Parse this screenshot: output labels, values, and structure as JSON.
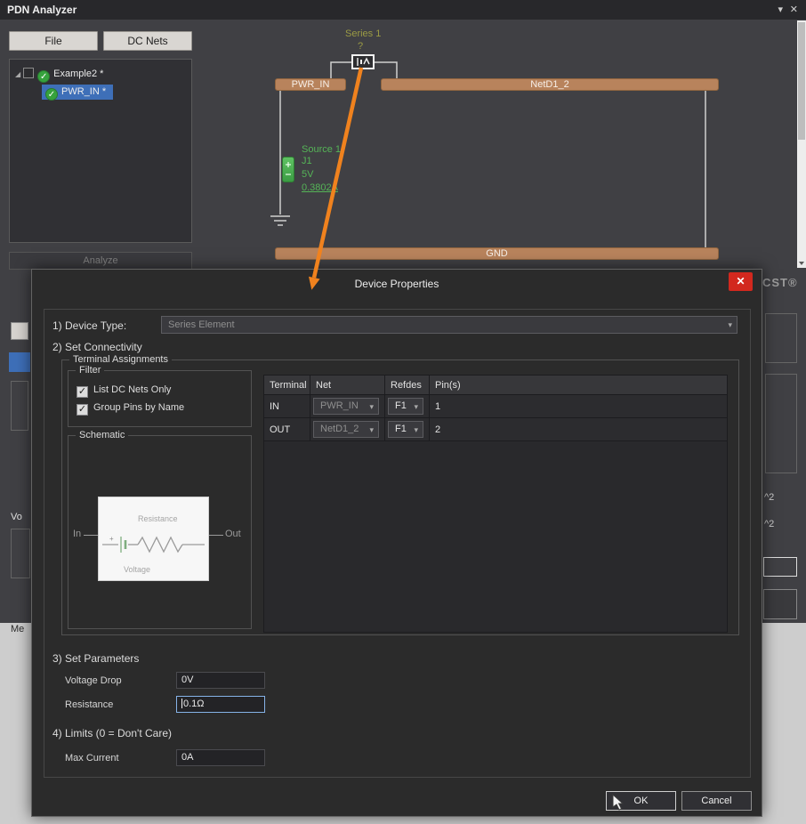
{
  "glyphs": {
    "check": "✓",
    "caret_down": "▾",
    "close": "✕",
    "expander": "◢"
  },
  "window": {
    "title": "PDN Analyzer"
  },
  "toolbar": {
    "file": "File",
    "dc_nets": "DC Nets"
  },
  "tree": {
    "root_label": "Example2 *",
    "child_label": "PWR_IN *"
  },
  "analyze_label": "Analyze",
  "canvas": {
    "series_label": "Series 1",
    "series_value": "?",
    "net_pwr": "PWR_IN",
    "net_netd": "NetD1_2",
    "net_gnd": "GND",
    "source_name": "Source 1",
    "source_refdes": "J1",
    "source_voltage": "5V",
    "source_current": "0.3802A"
  },
  "background": {
    "cst": "CST®",
    "frag_vo": "Vo",
    "frag_me": "Me",
    "frag_sq1": "^2",
    "frag_sq2": "^2"
  },
  "dialog": {
    "title": "Device Properties",
    "device_type_label": "1) Device Type:",
    "device_type_value": "Series Element",
    "connectivity_label": "2) Set Connectivity",
    "terminal_assignments_label": "Terminal Assignments",
    "filter": {
      "label": "Filter",
      "options": [
        {
          "label": "List DC Nets Only",
          "checked": true
        },
        {
          "label": "Group Pins by Name",
          "checked": true
        }
      ]
    },
    "schematic": {
      "label": "Schematic",
      "in": "In",
      "out": "Out",
      "resistance": "Resistance",
      "voltage": "Voltage",
      "plus": "+"
    },
    "table": {
      "headers": [
        "Terminal",
        "Net",
        "Refdes",
        "Pin(s)"
      ],
      "rows": [
        {
          "terminal": "IN",
          "net": "PWR_IN",
          "refdes": "F1",
          "pins": "1"
        },
        {
          "terminal": "OUT",
          "net": "NetD1_2",
          "refdes": "F1",
          "pins": "2"
        }
      ]
    },
    "parameters_label": "3) Set Parameters",
    "voltage_drop": {
      "label": "Voltage Drop",
      "value": "0V"
    },
    "resistance": {
      "label": "Resistance",
      "value": "0.1Ω"
    },
    "limits_label": "4) Limits (0 = Don't Care)",
    "max_current": {
      "label": "Max Current",
      "value": "0A"
    },
    "ok_label": "OK",
    "cancel_label": "Cancel"
  }
}
